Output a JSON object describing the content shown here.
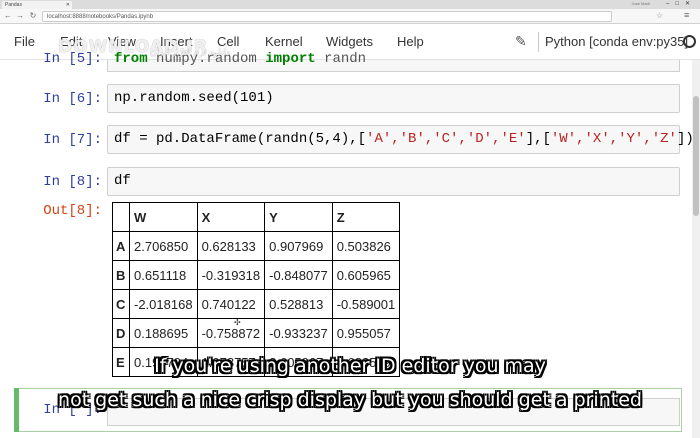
{
  "browser": {
    "tab_title": "Pandas",
    "user_label": "Jose Marti",
    "url": "localhost:8888/notebooks/Pandas.ipynb"
  },
  "menubar": {
    "items": [
      "File",
      "Edit",
      "View",
      "Insert",
      "Cell",
      "Kernel",
      "Widgets",
      "Help"
    ],
    "kernel": "Python [conda env:py35]"
  },
  "watermark": {
    "line1": "DOWNLOAD.IR",
    "line2": "دانلود نرم افزار ایران"
  },
  "cells": {
    "cut": {
      "prompt": "In [5]:",
      "code": "from numpy.random import randn"
    },
    "seed": {
      "prompt": "In [6]:",
      "code": "np.random.seed(101)"
    },
    "df_create": {
      "prompt": "In [7]:",
      "code_pre": "df = pd.DataFrame(randn(5,4),[",
      "code_idx": "'A','B','C','D','E'",
      "code_mid": "],[",
      "code_cols": "'W','X','Y','Z'",
      "code_post": "])"
    },
    "df_show": {
      "prompt": "In [8]:",
      "code": "df"
    },
    "output": {
      "prompt": "Out[8]:"
    },
    "active": {
      "prompt": "In [ ]:"
    }
  },
  "table": {
    "columns": [
      "W",
      "X",
      "Y",
      "Z"
    ],
    "rows": [
      {
        "index": "A",
        "values": [
          "2.706850",
          "0.628133",
          "0.907969",
          "0.503826"
        ]
      },
      {
        "index": "B",
        "values": [
          "0.651118",
          "-0.319318",
          "-0.848077",
          "0.605965"
        ]
      },
      {
        "index": "C",
        "values": [
          "-2.018168",
          "0.740122",
          "0.528813",
          "-0.589001"
        ]
      },
      {
        "index": "D",
        "values": [
          "0.188695",
          "-0.758872",
          "-0.933237",
          "0.955057"
        ]
      },
      {
        "index": "E",
        "values": [
          "0.190794",
          "1.978757",
          "2.605967",
          "0.683509"
        ]
      }
    ]
  },
  "subtitles": {
    "line1": "If you're using another ID editor you may",
    "line2": "not get such a nice crisp display but you should get a printed"
  },
  "colors": {
    "in_prompt": "#303f9f",
    "out_prompt": "#d84315",
    "active_bar": "#66bb6a",
    "string": "#ba2121"
  }
}
